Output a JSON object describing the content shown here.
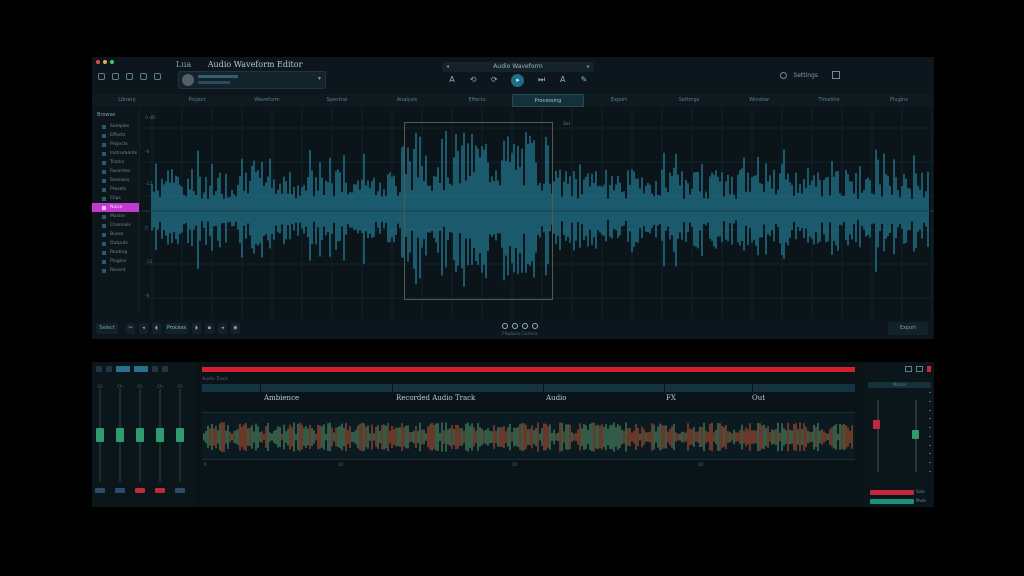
{
  "window": {
    "menu": "Lua",
    "title": "Audio Waveform Editor",
    "project": {
      "avatar": "user-avatar"
    }
  },
  "transport": {
    "title": "Audio Waveform",
    "left_arrow": "◂",
    "right_arrow": "▸",
    "buttons": [
      "A",
      "⟲",
      "⟳",
      "▸",
      "⏭",
      "A",
      "✎"
    ]
  },
  "top_right": {
    "settings_label": "Settings"
  },
  "tabs": [
    "Library",
    "Project",
    "Waveform",
    "Spectral",
    "Analysis",
    "Effects",
    "Processing",
    "Export",
    "Settings",
    "Window",
    "Timeline",
    "Plugins"
  ],
  "active_tab": 6,
  "sidebar": {
    "header": "Browse",
    "items": [
      "Samples",
      "Effects",
      "Projects",
      "Instruments",
      "Tracks",
      "Favorites",
      "Sessions",
      "Presets",
      "Clips",
      "Noise",
      "Master",
      "Channels",
      "Buses",
      "Outputs",
      "Routing",
      "Plugins",
      "Recent"
    ],
    "selected_index": 9
  },
  "waveform": {
    "y_labels": [
      "0 dB",
      "-6",
      "-12",
      "0",
      "-12",
      "-6"
    ],
    "selection_tag": "Sel"
  },
  "toolbar": {
    "left_button": "Select",
    "tools": [
      "✂",
      "◂",
      "◖",
      "Process",
      "◗",
      "▪",
      "◂",
      "◉"
    ],
    "center_caption": "Playback Controls",
    "right_button": "Export"
  },
  "mixer": {
    "channels": [
      {
        "label": "Ch 1",
        "level": 0.44,
        "button_color": "#2a4c6a"
      },
      {
        "label": "Ch 2",
        "level": 0.44,
        "button_color": "#2a4c6a"
      },
      {
        "label": "Ch 3",
        "level": 0.44,
        "button_color": "#c2293a"
      },
      {
        "label": "Ch 4",
        "level": 0.44,
        "button_color": "#c2293a"
      },
      {
        "label": "Ch 5",
        "level": 0.44,
        "button_color": "#2a4c6a"
      }
    ]
  },
  "arrange": {
    "track_name": "Audio Track",
    "lane_labels": [
      "Ambience",
      "Recorded Audio Track",
      "Audio",
      "FX",
      "Out"
    ],
    "timeline_labels": [
      "0",
      "10",
      "20",
      "30"
    ]
  },
  "right_panel": {
    "header": "Master",
    "buttons": [
      {
        "label": "Solo",
        "color": "#c2293a"
      },
      {
        "label": "Mute",
        "color": "#1e8f78"
      }
    ]
  },
  "colors": {
    "accent": "#2a9fc0",
    "selection": "#c23ad3",
    "record": "#d4202d",
    "clip_wave_a": "#c7562f",
    "clip_wave_b": "#5a9f6f"
  }
}
